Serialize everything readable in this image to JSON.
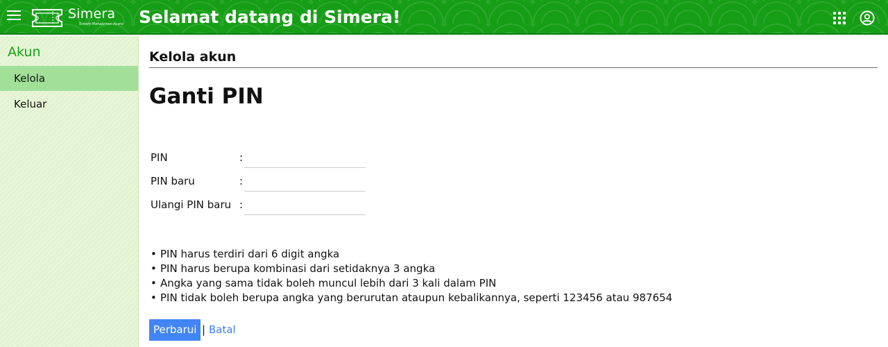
{
  "header": {
    "app_name": "Simera",
    "app_tagline": "Sistem Manajemen Acara",
    "welcome": "Selamat datang di Simera!",
    "icons": {
      "menu": "hamburger-menu-icon",
      "apps": "apps-grid-icon",
      "account": "account-circle-icon"
    },
    "colors": {
      "header_bg": "#169e16"
    }
  },
  "sidebar": {
    "title": "Akun",
    "items": [
      {
        "label": "Kelola",
        "active": true
      },
      {
        "label": "Keluar",
        "active": false
      }
    ],
    "colors": {
      "bg": "#e2f3cf",
      "active_bg": "#a2e09a",
      "title": "#17a117"
    }
  },
  "main": {
    "section_title": "Kelola akun",
    "page_title": "Ganti PIN",
    "form": {
      "colon": ":",
      "fields": [
        {
          "label": "PIN",
          "value": ""
        },
        {
          "label": "PIN baru",
          "value": ""
        },
        {
          "label": "Ulangi PIN baru",
          "value": ""
        }
      ]
    },
    "bullet": "•",
    "rules": [
      "PIN harus terdiri dari 6 digit angka",
      "PIN harus berupa kombinasi dari setidaknya 3 angka",
      "Angka yang sama tidak boleh muncul lebih dari 3 kali dalam PIN",
      "PIN tidak boleh berupa angka yang berurutan ataupun kebalikannya, seperti 123456 atau 987654"
    ],
    "actions": {
      "update_label": "Perbarui",
      "separator": "|",
      "cancel_label": "Batal"
    },
    "colors": {
      "primary_button": "#4285f4",
      "link": "#3f7fe6"
    }
  }
}
